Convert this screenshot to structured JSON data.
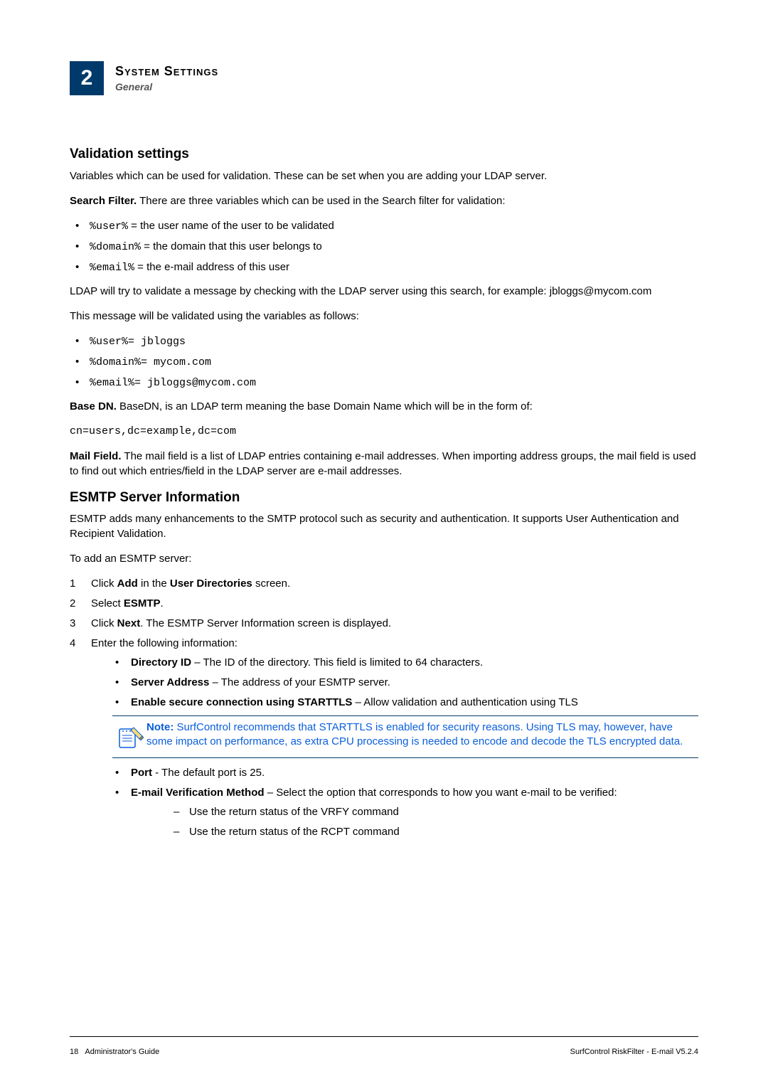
{
  "header": {
    "chapter_number": "2",
    "title": "System Settings",
    "subtitle": "General"
  },
  "section_validation": {
    "heading": "Validation settings",
    "intro": "Variables which can be used for validation. These can be set when you are adding your LDAP server.",
    "search_filter_label": "Search Filter.",
    "search_filter_text": " There are three variables which can be used in the Search filter for validation:",
    "vars": [
      {
        "code": "%user%",
        "text": " = the user name of the user to be validated"
      },
      {
        "code": "%domain%",
        "text": " = the domain that this user belongs to"
      },
      {
        "code": "%email%",
        "text": " = the e-mail address of this user"
      }
    ],
    "ldap_try": "LDAP will try to validate a message by checking with the LDAP server using this search, for example: jbloggs@mycom.com",
    "validated_intro": "This message will be validated using the variables as follows:",
    "validated": [
      "%user%= jbloggs",
      "%domain%= mycom.com",
      "%email%= jbloggs@mycom.com"
    ],
    "base_dn_label": "Base DN.",
    "base_dn_text": " BaseDN, is an LDAP term meaning the base Domain Name which will be in the form of:",
    "base_dn_code": "cn=users,dc=example,dc=com",
    "mail_field_label": "Mail Field.",
    "mail_field_text": " The mail field is a list of LDAP entries containing e-mail addresses. When importing address groups, the mail field is used to find out which entries/field in the LDAP server are e-mail addresses."
  },
  "section_esmtp": {
    "heading": "ESMTP Server Information",
    "intro": "ESMTP adds many enhancements to the SMTP protocol such as security and authentication. It supports User Authentication and Recipient Validation.",
    "add_intro": "To add an ESMTP server:",
    "steps": {
      "s1_a": "Click ",
      "s1_b": "Add",
      "s1_c": " in the ",
      "s1_d": "User Directories",
      "s1_e": " screen.",
      "s2_a": "Select ",
      "s2_b": "ESMTP",
      "s2_c": ".",
      "s3_a": "Click ",
      "s3_b": "Next",
      "s3_c": ". The ESMTP Server Information screen is displayed.",
      "s4": "Enter the following information:"
    },
    "fields": {
      "dir_id_label": "Directory ID",
      "dir_id_text": " – The ID of the directory. This field is limited to 64 characters.",
      "server_addr_label": "Server Address",
      "server_addr_text": " – The address of your ESMTP server.",
      "starttls_label": "Enable secure connection using STARTTLS",
      "starttls_text": " – Allow validation and authentication using TLS",
      "port_label": "Port",
      "port_text": " - The default port is 25.",
      "verify_label": "E-mail Verification Method",
      "verify_text": " – Select the option that corresponds to how you want e-mail to be verified:",
      "verify_opt1": "Use the return status of the VRFY command",
      "verify_opt2": "Use the return status of the RCPT command"
    },
    "note": {
      "label": "Note:",
      "text": "  SurfControl recommends that STARTTLS is enabled for security reasons. Using TLS may, however, have some impact on performance, as extra CPU processing is needed to encode and decode the TLS encrypted data."
    }
  },
  "footer": {
    "page": "18",
    "guide": "Administrator's Guide",
    "product": "SurfControl RiskFilter - E-mail V5.2.4"
  }
}
